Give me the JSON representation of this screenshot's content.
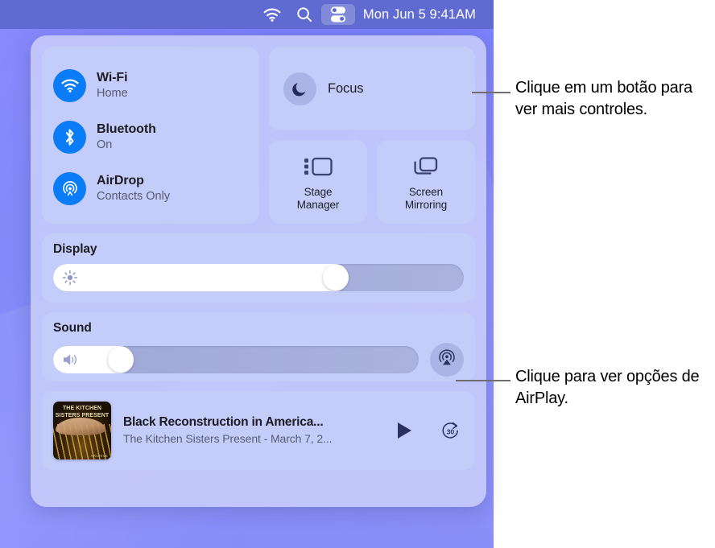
{
  "menubar": {
    "wifi_icon": "wifi-icon",
    "search_icon": "search-icon",
    "control_center_icon": "control-center-icon",
    "clock": "Mon Jun 5  9:41AM"
  },
  "control_center": {
    "connectivity": [
      {
        "icon": "wifi-icon",
        "title": "Wi-Fi",
        "status": "Home"
      },
      {
        "icon": "bluetooth-icon",
        "title": "Bluetooth",
        "status": "On"
      },
      {
        "icon": "airdrop-icon",
        "title": "AirDrop",
        "status": "Contacts Only"
      }
    ],
    "focus": {
      "icon": "moon-icon",
      "label": "Focus"
    },
    "tiles": [
      {
        "icon": "stage-manager-icon",
        "label": "Stage\nManager",
        "line1": "Stage",
        "line2": "Manager"
      },
      {
        "icon": "screen-mirroring-icon",
        "label": "Screen\nMirroring",
        "line1": "Screen",
        "line2": "Mirroring"
      }
    ],
    "display": {
      "title": "Display",
      "glyph": "brightness-icon",
      "value_percent": 72
    },
    "sound": {
      "title": "Sound",
      "glyph": "volume-icon",
      "value_percent": 22,
      "airplay_icon": "airplay-icon"
    },
    "now_playing": {
      "album_art_title": "THE KITCHEN SISTERS PRESENT",
      "album_art_footer": "ARCHIVE",
      "title": "Black Reconstruction in America...",
      "subtitle": "The Kitchen Sisters Present - March 7, 2...",
      "play_icon": "play-icon",
      "skip_icon": "skip-forward-30-icon",
      "skip_label": "30"
    }
  },
  "callouts": {
    "controls": "Clique em um botão para ver mais controles.",
    "airplay": "Clique para ver opções de AirPlay."
  },
  "colors": {
    "accent_blue": "#0a7cf6",
    "wallpaper": "#7f86f7",
    "menubar": "#5f6bd0",
    "panel": "#cdd2fa",
    "module": "#c4ccfa",
    "text_primary": "#1c1c22",
    "text_secondary": "#565a70",
    "leader_line": "#6e6e6e"
  }
}
